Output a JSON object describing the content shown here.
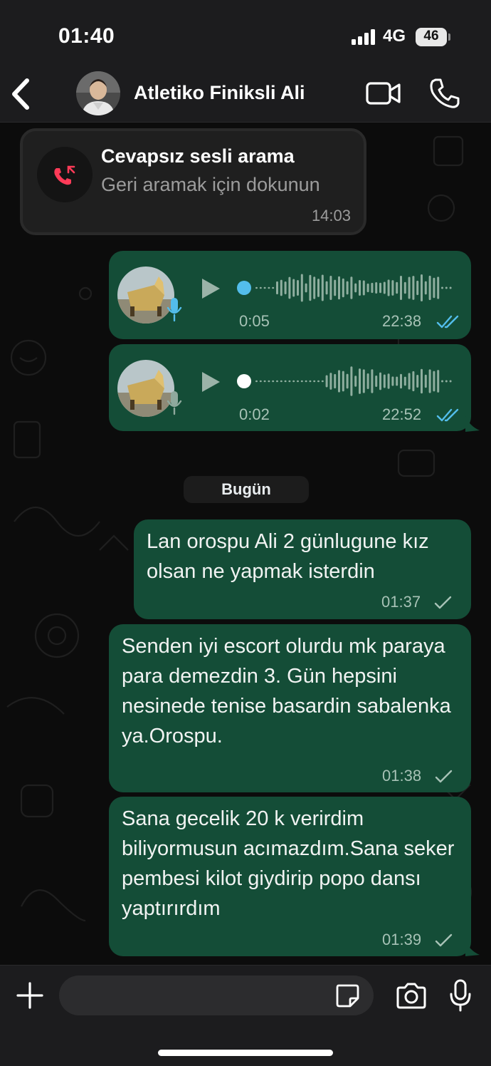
{
  "status_bar": {
    "time": "01:40",
    "network": "4G",
    "battery": "46"
  },
  "header": {
    "contact_name": "Atletiko Finiksli Ali",
    "back_icon": "chevron-left-icon",
    "video_icon": "video-camera-icon",
    "call_icon": "phone-icon"
  },
  "missed_call": {
    "title": "Cevapsız sesli arama",
    "subtitle": "Geri aramak için dokunun",
    "time": "14:03",
    "icon": "missed-call-icon",
    "accent": "#ff3b58"
  },
  "voice_messages": [
    {
      "duration": "0:05",
      "time": "22:38",
      "status": "read",
      "played": true,
      "progress": 0.0
    },
    {
      "duration": "0:02",
      "time": "22:52",
      "status": "read",
      "played": false,
      "progress": 0.0
    }
  ],
  "date_divider": "Bugün",
  "messages": [
    {
      "text": "Lan orospu Ali  2 günlugune kız olsan ne yapmak isterdin",
      "time": "01:37",
      "status": "sent"
    },
    {
      "text": "Senden iyi escort olurdu mk paraya para demezdin 3. Gün hepsini nesinede tenise basardin sabalenka ya.Orospu.",
      "time": "01:38",
      "status": "sent"
    },
    {
      "text": "Sana gecelik 20 k verirdim biliyormusun acımazdım.Sana seker pembesi kilot giydirip popo dansı yaptırırdım",
      "time": "01:39",
      "status": "sent"
    }
  ],
  "composer": {
    "placeholder": "",
    "plus_icon": "plus-icon",
    "sticker_icon": "sticker-icon",
    "camera_icon": "camera-icon",
    "mic_icon": "microphone-icon"
  },
  "colors": {
    "outgoing_bubble": "#144d37",
    "read_ticks": "#53bdeb",
    "played_dot": "#53bdeb",
    "header_bg": "#1c1c1e"
  }
}
